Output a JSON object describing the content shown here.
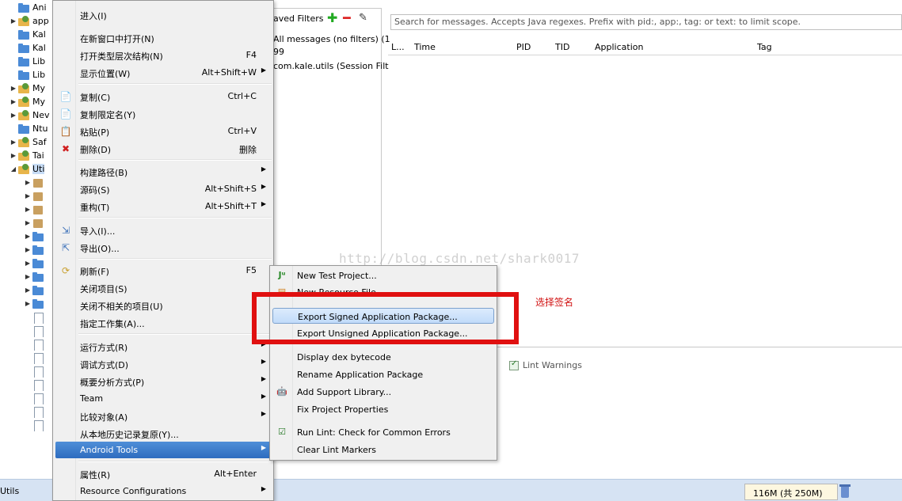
{
  "tree": {
    "items": [
      {
        "label": "Ani",
        "icon": "folder-icon",
        "arrow": ""
      },
      {
        "label": "app",
        "icon": "project-icon",
        "arrow": "▶"
      },
      {
        "label": "Kal",
        "icon": "folder-icon",
        "arrow": ""
      },
      {
        "label": "Kal",
        "icon": "folder-icon",
        "arrow": ""
      },
      {
        "label": "Lib",
        "icon": "folder-icon",
        "arrow": ""
      },
      {
        "label": "Lib",
        "icon": "folder-icon",
        "arrow": ""
      },
      {
        "label": "My",
        "icon": "project-icon",
        "arrow": "▶"
      },
      {
        "label": "My",
        "icon": "project-icon",
        "arrow": "▶"
      },
      {
        "label": "Nev",
        "icon": "project-icon",
        "arrow": "▶"
      },
      {
        "label": "Ntu",
        "icon": "folder-icon",
        "arrow": ""
      },
      {
        "label": "Saf",
        "icon": "project-icon",
        "arrow": "▶"
      },
      {
        "label": "Tai",
        "icon": "project-icon",
        "arrow": "▶"
      },
      {
        "label": "Uti",
        "icon": "project-icon",
        "arrow": "◢"
      }
    ]
  },
  "filters": {
    "header": "aved Filters",
    "rows": [
      "All messages (no filters) (1",
      "99",
      "com.kale.utils (Session Filt"
    ]
  },
  "logcat": {
    "search_placeholder": "Search for messages. Accepts Java regexes. Prefix with pid:, app:, tag: or text: to limit scope.",
    "columns": [
      "L...",
      "Time",
      "PID",
      "TID",
      "Application",
      "Tag"
    ],
    "lint_tab": "Lint Warnings"
  },
  "menu": {
    "items": [
      {
        "label": "进入(I)",
        "accel": "",
        "sub": false
      },
      {
        "label": "在新窗口中打开(N)",
        "accel": "",
        "sub": false
      },
      {
        "label": "打开类型层次结构(N)",
        "accel": "F4",
        "sub": false
      },
      {
        "label": "显示位置(W)",
        "accel": "Alt+Shift+W",
        "sub": true
      },
      {
        "label": "复制(C)",
        "accel": "Ctrl+C",
        "sub": false
      },
      {
        "label": "复制限定名(Y)",
        "accel": "",
        "sub": false
      },
      {
        "label": "粘贴(P)",
        "accel": "Ctrl+V",
        "sub": false
      },
      {
        "label": "删除(D)",
        "accel": "删除",
        "sub": false
      },
      {
        "label": "构建路径(B)",
        "accel": "",
        "sub": true
      },
      {
        "label": "源码(S)",
        "accel": "Alt+Shift+S",
        "sub": true
      },
      {
        "label": "重构(T)",
        "accel": "Alt+Shift+T",
        "sub": true
      },
      {
        "label": "导入(I)...",
        "accel": "",
        "sub": false
      },
      {
        "label": "导出(O)...",
        "accel": "",
        "sub": false
      },
      {
        "label": "刷新(F)",
        "accel": "F5",
        "sub": false
      },
      {
        "label": "关闭项目(S)",
        "accel": "",
        "sub": false
      },
      {
        "label": "关闭不相关的项目(U)",
        "accel": "",
        "sub": false
      },
      {
        "label": "指定工作集(A)...",
        "accel": "",
        "sub": false
      },
      {
        "label": "运行方式(R)",
        "accel": "",
        "sub": true
      },
      {
        "label": "调试方式(D)",
        "accel": "",
        "sub": true
      },
      {
        "label": "概要分析方式(P)",
        "accel": "",
        "sub": true
      },
      {
        "label": "Team",
        "accel": "",
        "sub": true
      },
      {
        "label": "比较对象(A)",
        "accel": "",
        "sub": true
      },
      {
        "label": "从本地历史记录复原(Y)...",
        "accel": "",
        "sub": false
      },
      {
        "label": "Android Tools",
        "accel": "",
        "sub": true
      },
      {
        "label": "属性(R)",
        "accel": "Alt+Enter",
        "sub": false
      },
      {
        "label": "Resource Configurations",
        "accel": "",
        "sub": true
      }
    ]
  },
  "submenu": {
    "items": [
      {
        "label": "New Test Project..."
      },
      {
        "label": "New Resource File..."
      },
      {
        "label": "Export Signed Application Package..."
      },
      {
        "label": "Export Unsigned Application Package..."
      },
      {
        "label": "Display dex bytecode"
      },
      {
        "label": "Rename Application Package"
      },
      {
        "label": "Add Support Library..."
      },
      {
        "label": "Fix Project Properties"
      },
      {
        "label": "Run Lint: Check for Common Errors"
      },
      {
        "label": "Clear Lint Markers"
      }
    ]
  },
  "watermark": "http://blog.csdn.net/shark0017",
  "annotation": "选择签名",
  "status": {
    "project": "Utils",
    "heap": "116M (共 250M)"
  },
  "colors": {
    "annotation": "#e01010",
    "menu_highlight": "#2e6cbf",
    "statusbar": "#d6e3f3"
  }
}
